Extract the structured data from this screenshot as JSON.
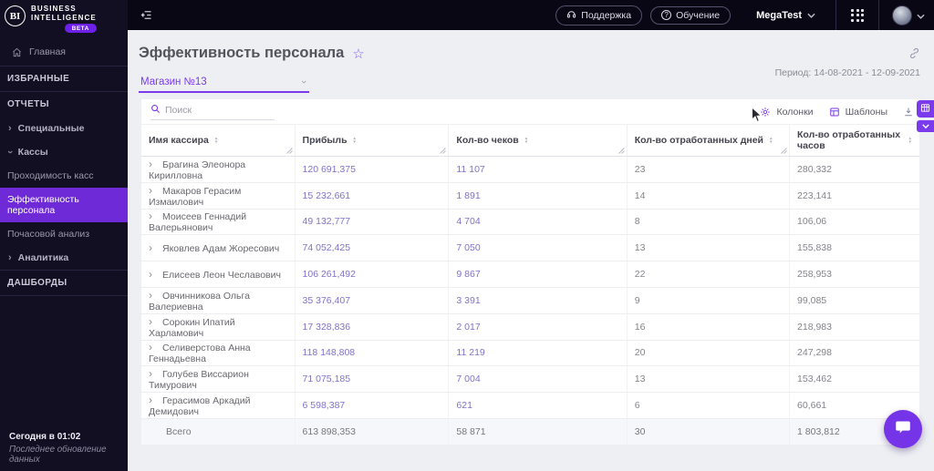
{
  "brand": {
    "initials": "BI",
    "line1": "BUSINESS",
    "line2": "INTELLIGENCE",
    "beta": "BETA"
  },
  "topbar": {
    "support": "Поддержка",
    "training": "Обучение",
    "account": "MegaTest"
  },
  "sidebar": {
    "items": [
      {
        "label": "Главная"
      },
      {
        "label": "ИЗБРАННЫЕ"
      },
      {
        "label": "ОТЧЕТЫ"
      },
      {
        "label": "Специальные"
      },
      {
        "label": "Кассы"
      },
      {
        "label": "Проходимость касс"
      },
      {
        "label": "Эффективность персонала"
      },
      {
        "label": "Почасовой анализ"
      },
      {
        "label": "Аналитика"
      },
      {
        "label": "ДАШБОРДЫ"
      }
    ],
    "last_update_time": "Сегодня в 01:02",
    "last_update_caption": "Последнее обновление данных"
  },
  "page": {
    "title": "Эффективность персонала",
    "period": "Период: 14-08-2021 - 12-09-2021",
    "store": "Магазин №13",
    "search_placeholder": "Поиск",
    "columns_button": "Колонки",
    "templates_button": "Шаблоны"
  },
  "table": {
    "headers": [
      "Имя кассира",
      "Прибыль",
      "Кол-во чеков",
      "Кол-во отработанных дней",
      "Кол-во отработанных часов"
    ],
    "rows": [
      {
        "name": "Брагина Элеонора Кирилловна",
        "profit": "120 691,375",
        "checks": "11 107",
        "days": "23",
        "hours": "280,332"
      },
      {
        "name": "Макаров Герасим Измаилович",
        "profit": "15 232,661",
        "checks": "1 891",
        "days": "14",
        "hours": "223,141"
      },
      {
        "name": "Моисеев Геннадий Валерьянович",
        "profit": "49 132,777",
        "checks": "4 704",
        "days": "8",
        "hours": "106,06"
      },
      {
        "name": "Яковлев Адам Жоресович",
        "profit": "74 052,425",
        "checks": "7 050",
        "days": "13",
        "hours": "155,838"
      },
      {
        "name": "Елисеев Леон Чеславович",
        "profit": "106 261,492",
        "checks": "9 867",
        "days": "22",
        "hours": "258,953"
      },
      {
        "name": "Овчинникова Ольга Валериевна",
        "profit": "35 376,407",
        "checks": "3 391",
        "days": "9",
        "hours": "99,085"
      },
      {
        "name": "Сорокин Ипатий Харламович",
        "profit": "17 328,836",
        "checks": "2 017",
        "days": "16",
        "hours": "218,983"
      },
      {
        "name": "Селиверстова Анна Геннадьевна",
        "profit": "118 148,808",
        "checks": "11 219",
        "days": "20",
        "hours": "247,298"
      },
      {
        "name": "Голубев Виссарион Тимурович",
        "profit": "71 075,185",
        "checks": "7 004",
        "days": "13",
        "hours": "153,462"
      },
      {
        "name": "Герасимов Аркадий Демидович",
        "profit": "6 598,387",
        "checks": "621",
        "days": "6",
        "hours": "60,661"
      }
    ],
    "total": {
      "label": "Всего",
      "profit": "613 898,353",
      "checks": "58 871",
      "days": "30",
      "hours": "1 803,812"
    }
  },
  "icons": {
    "star": "☆",
    "row_expand": "›",
    "chevron": "›",
    "question": "?",
    "sort_up": "▲",
    "sort_down": "▼"
  },
  "colors": {
    "accent": "#7c3aed",
    "active_item": "#6e2ad6",
    "value_text": "#8173ca",
    "topbar_bg": "#090714",
    "sidebar_bg": "#120f22",
    "content_bg": "#edeff3"
  }
}
